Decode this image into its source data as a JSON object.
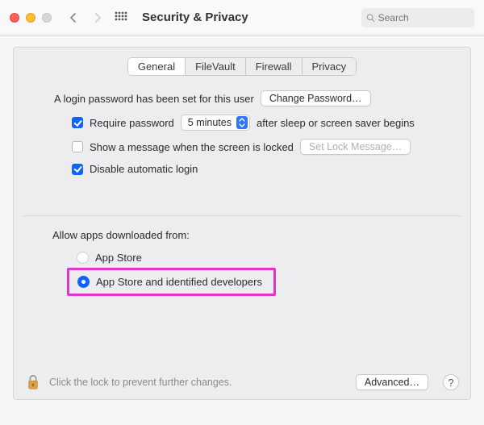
{
  "window": {
    "title": "Security & Privacy"
  },
  "search": {
    "placeholder": "Search"
  },
  "tabs": {
    "general": "General",
    "filevault": "FileVault",
    "firewall": "Firewall",
    "privacy": "Privacy"
  },
  "general": {
    "login_password_set": "A login password has been set for this user",
    "change_password_btn": "Change Password…",
    "require_password": "Require password",
    "require_password_delay": "5 minutes",
    "after_sleep_text": "after sleep or screen saver begins",
    "show_message": "Show a message when the screen is locked",
    "set_lock_message_btn": "Set Lock Message…",
    "disable_auto_login": "Disable automatic login"
  },
  "allow_apps": {
    "header": "Allow apps downloaded from:",
    "app_store": "App Store",
    "app_store_identified": "App Store and identified developers"
  },
  "footer": {
    "lock_text": "Click the lock to prevent further changes.",
    "advanced_btn": "Advanced…",
    "help": "?"
  }
}
